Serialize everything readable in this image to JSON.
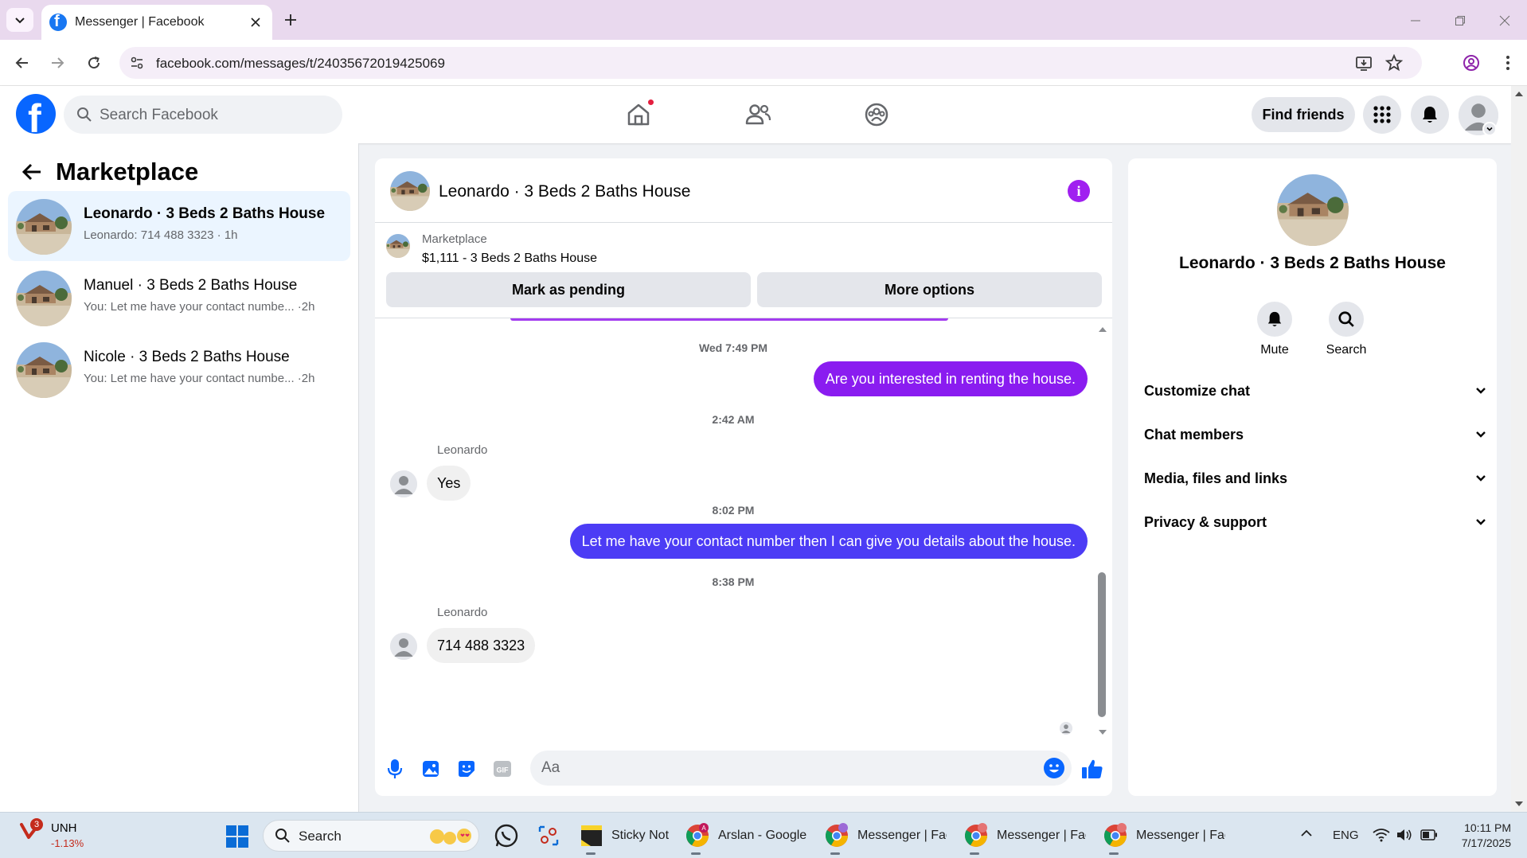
{
  "browser": {
    "tab_title": "Messenger | Facebook",
    "url": "facebook.com/messages/t/24035672019425069"
  },
  "fbnav": {
    "search_placeholder": "Search Facebook",
    "find_friends": "Find friends"
  },
  "left_panel": {
    "title": "Marketplace",
    "conversations": [
      {
        "name": "Leonardo · 3 Beds 2 Baths House",
        "preview": "Leonardo: 714 488 3323 · 1h",
        "active": true
      },
      {
        "name": "Manuel · 3 Beds 2 Baths House",
        "preview": "You: Let me have your contact numbe... ·2h",
        "active": false
      },
      {
        "name": "Nicole · 3 Beds 2 Baths House",
        "preview": "You: Let me have your contact numbe... ·2h",
        "active": false
      }
    ]
  },
  "chat": {
    "title": "Leonardo · 3 Beds 2 Baths House",
    "listing": {
      "type": "Marketplace",
      "title": "$1,111 - 3 Beds 2 Baths House",
      "mark_pending": "Mark as pending",
      "more_options": "More options"
    },
    "messages": [
      {
        "kind": "timestamp",
        "text": "Wed 7:49 PM"
      },
      {
        "kind": "outgoing",
        "text": "Are you interested in renting the house."
      },
      {
        "kind": "timestamp",
        "text": "2:42 AM"
      },
      {
        "kind": "sender",
        "text": "Leonardo"
      },
      {
        "kind": "incoming",
        "text": "Yes"
      },
      {
        "kind": "timestamp",
        "text": "8:02 PM"
      },
      {
        "kind": "outgoing",
        "text": "Let me have your contact number then I can give you details about the house."
      },
      {
        "kind": "timestamp",
        "text": "8:38 PM"
      },
      {
        "kind": "sender",
        "text": "Leonardo"
      },
      {
        "kind": "incoming",
        "text": "714 488 3323"
      }
    ],
    "composer_placeholder": "Aa"
  },
  "right_panel": {
    "name": "Leonardo · 3 Beds 2 Baths House",
    "actions": {
      "mute": "Mute",
      "search": "Search"
    },
    "sections": [
      "Customize chat",
      "Chat members",
      "Media, files and links",
      "Privacy & support"
    ]
  },
  "taskbar": {
    "stock_symbol": "UNH",
    "stock_change": "-1.13%",
    "stock_badge": "3",
    "search_placeholder": "Search",
    "apps": [
      {
        "label": "Sticky Not"
      },
      {
        "label": "Arslan - Google"
      },
      {
        "label": "Messenger | Face"
      },
      {
        "label": "Messenger | Face"
      },
      {
        "label": "Messenger | Face"
      }
    ],
    "language": "ENG",
    "time": "10:11 PM",
    "date": "7/17/2025"
  },
  "colors": {
    "facebook_blue": "#0866ff",
    "outgoing_purple": "#8a1cf0",
    "outgoing_blue": "#4c3cf5",
    "active_conv_bg": "#ebf5ff",
    "info_purple": "#a020f0"
  }
}
